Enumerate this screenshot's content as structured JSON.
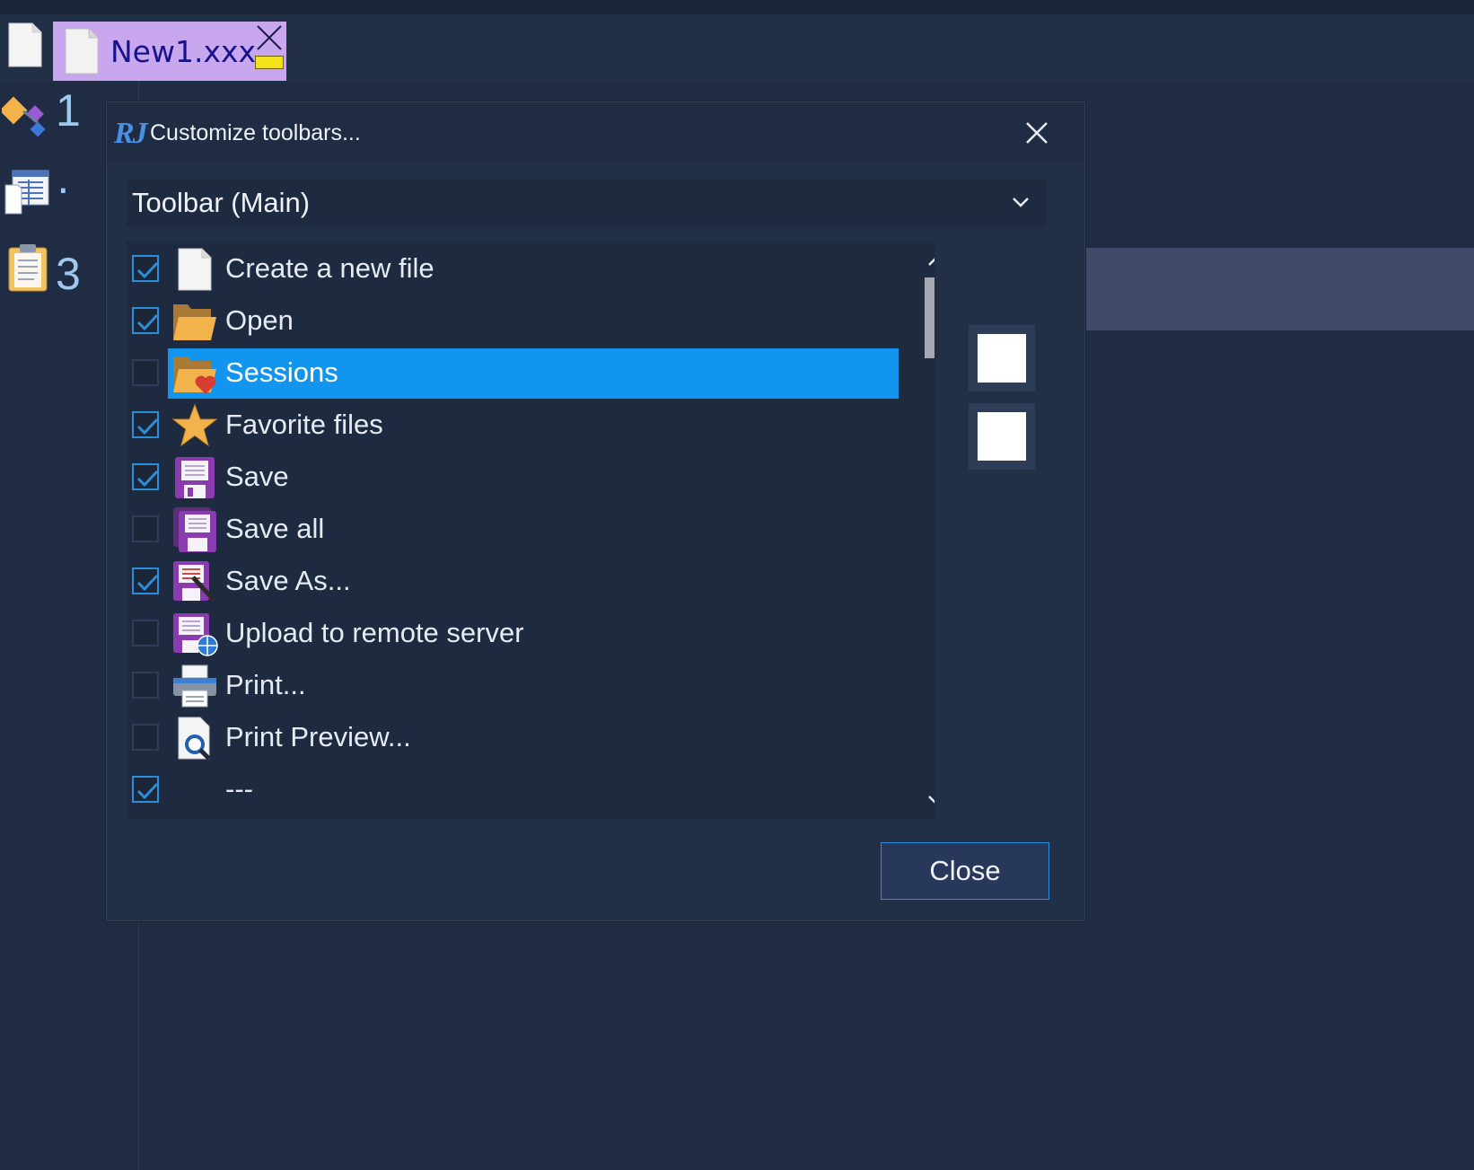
{
  "tab": {
    "filename": "New1.xxx"
  },
  "sidebar": {
    "items": [
      {
        "num": "1"
      },
      {
        "num": "·"
      },
      {
        "num": "3"
      }
    ]
  },
  "dialog": {
    "title": "Customize toolbars...",
    "toolbar_select": "Toolbar (Main)",
    "items": [
      {
        "label": "Create a new file",
        "checked": true,
        "icon": "new-file-icon"
      },
      {
        "label": "Open",
        "checked": true,
        "icon": "open-folder-icon"
      },
      {
        "label": "Sessions",
        "checked": false,
        "icon": "sessions-folder-icon",
        "selected": true
      },
      {
        "label": "Favorite files",
        "checked": true,
        "icon": "star-icon"
      },
      {
        "label": "Save",
        "checked": true,
        "icon": "save-icon"
      },
      {
        "label": "Save all",
        "checked": false,
        "icon": "save-all-icon"
      },
      {
        "label": "Save As...",
        "checked": true,
        "icon": "save-as-icon"
      },
      {
        "label": "Upload to remote server",
        "checked": false,
        "icon": "upload-icon"
      },
      {
        "label": "Print...",
        "checked": false,
        "icon": "printer-icon"
      },
      {
        "label": "Print Preview...",
        "checked": false,
        "icon": "print-preview-icon"
      },
      {
        "label": "---",
        "checked": true,
        "icon": "separator"
      }
    ],
    "close_label": "Close"
  },
  "colors": {
    "selection": "#1195ef",
    "background": "#1f2c43",
    "tab": "#c9a7ee"
  }
}
